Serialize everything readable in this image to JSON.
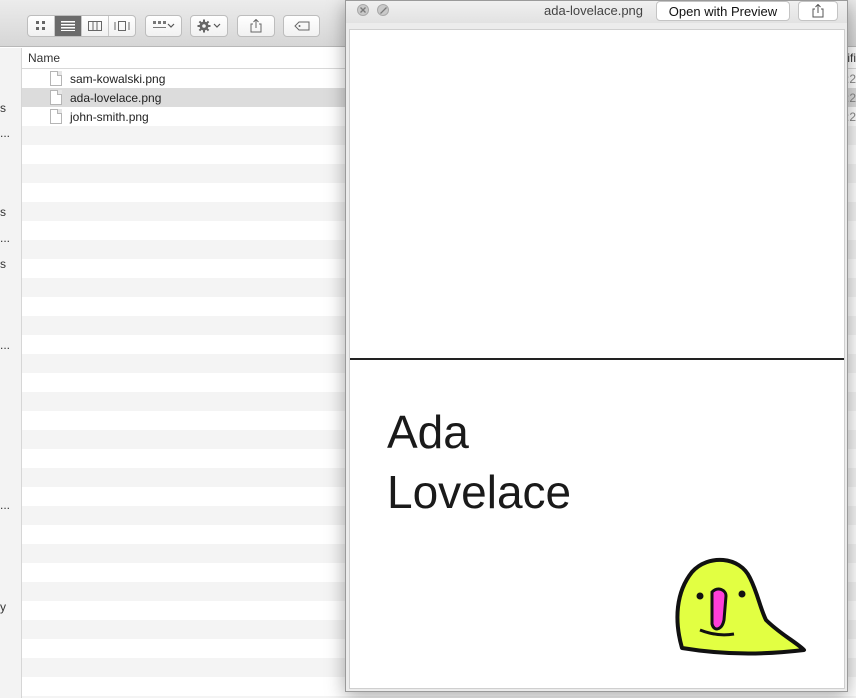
{
  "finder": {
    "toolbar": {
      "view_buttons": [
        "icon-view",
        "list-view",
        "column-view",
        "cover-flow-view"
      ],
      "active_view": "list-view"
    },
    "sidebar_fragments": [
      "s",
      "...",
      "s",
      "...",
      "s",
      "...",
      "...",
      "y"
    ],
    "columns": {
      "name": "Name",
      "date_modified_fragment": "ifi"
    },
    "files": [
      {
        "name": "sam-kowalski.png",
        "date_fragment": ":2",
        "selected": false
      },
      {
        "name": "ada-lovelace.png",
        "date_fragment": ":2",
        "selected": true
      },
      {
        "name": "john-smith.png",
        "date_fragment": ":2",
        "selected": false
      }
    ]
  },
  "quicklook": {
    "title": "ada-lovelace.png",
    "open_button_label": "Open with Preview",
    "card": {
      "name_line1": "Ada",
      "name_line2": "Lovelace"
    },
    "colors": {
      "parrot_body": "#e2ff42",
      "parrot_beak": "#ff3fd8",
      "fold_line": "#222222"
    }
  }
}
